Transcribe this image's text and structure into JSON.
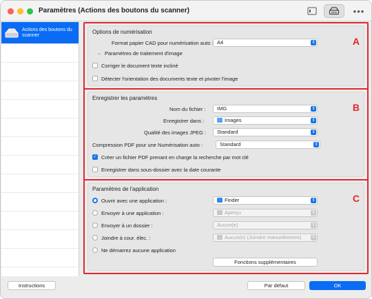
{
  "window": {
    "title": "Paramètres (Actions des boutons du scanner)"
  },
  "toolbar": {
    "more_label": "•••"
  },
  "sidebar": {
    "items": [
      {
        "label": "Actions des boutons du scanner",
        "icon": "scanner-icon",
        "selected": true
      }
    ]
  },
  "section_a": {
    "title": "Options de numérisation",
    "letter": "A",
    "paper_size_label": "Format papier CAD pour numérisation auto :",
    "paper_size_value": "A4",
    "image_processing_label": "Paramètres de traitement d'image",
    "deskew_label": "Corriger le document texte incliné",
    "deskew_checked": false,
    "orientation_label": "Détecter l'orientation des documents texte et pivoter l'image",
    "orientation_checked": false
  },
  "section_b": {
    "title": "Enregistrer les paramètres",
    "letter": "B",
    "filename_label": "Nom du fichier :",
    "filename_value": "IMG",
    "save_in_label": "Enregistrer dans :",
    "save_in_value": "Images",
    "jpeg_quality_label": "Qualité des images JPEG :",
    "jpeg_quality_value": "Standard",
    "pdf_compression_label": "Compression PDF pour une Numérisation auto :",
    "pdf_compression_value": "Standard",
    "searchable_pdf_label": "Créer un fichier PDF prenant en charge la recherche par mot clé",
    "searchable_pdf_checked": true,
    "subfolder_label": "Enregistrer dans sous-dossier avec la date courante",
    "subfolder_checked": false
  },
  "section_c": {
    "title": "Paramètres de l'application",
    "letter": "C",
    "open_app_label": "Ouvrir avec une application :",
    "open_app_value": "Finder",
    "send_app_label": "Envoyer à une application :",
    "send_app_value": "Aperçu",
    "send_folder_label": "Envoyer à un dossier :",
    "send_folder_value": "Aucun(e)",
    "attach_email_label": "Joindre à cour. élec. :",
    "attach_email_value": "Aucun(e) (Joindre manuellement)",
    "no_app_label": "Ne démarrez aucune application",
    "more_functions_label": "Fonctions supplémentaires"
  },
  "footer": {
    "instructions_label": "Instructions",
    "default_label": "Par défaut",
    "ok_label": "OK"
  },
  "colors": {
    "accent": "#0a6cf5",
    "highlight_border": "#e0262f"
  }
}
